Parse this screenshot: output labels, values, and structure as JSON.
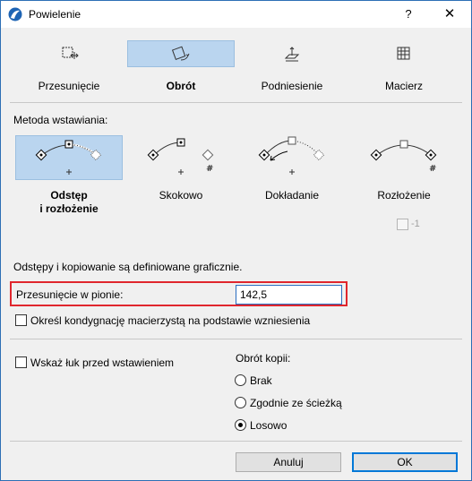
{
  "window": {
    "title": "Powielenie",
    "help_label": "?",
    "close_label": "✕"
  },
  "tabs": [
    {
      "label": "Przesunięcie",
      "icon": "move-icon",
      "active": false
    },
    {
      "label": "Obrót",
      "icon": "rotate-icon",
      "active": true
    },
    {
      "label": "Podniesienie",
      "icon": "elevate-icon",
      "active": false
    },
    {
      "label": "Macierz",
      "icon": "matrix-icon",
      "active": false
    }
  ],
  "method_section": {
    "label": "Metoda wstawiania:",
    "methods": [
      {
        "label_line1": "Odstęp",
        "label_line2": "i rozłożenie",
        "icon": "spacing-distribution-icon",
        "active": true
      },
      {
        "label_line1": "Skokowo",
        "label_line2": "",
        "icon": "step-icon",
        "active": false
      },
      {
        "label_line1": "Dokładanie",
        "label_line2": "",
        "icon": "append-icon",
        "active": false
      },
      {
        "label_line1": "Rozłożenie",
        "label_line2": "",
        "icon": "distribute-icon",
        "active": false
      }
    ],
    "minus_one_label": "-1",
    "minus_one_checked": false,
    "minus_one_enabled": false
  },
  "info_text": "Odstępy i kopiowanie są definiowane graficznie.",
  "vertical_offset": {
    "label": "Przesunięcie w pionie:",
    "value": "142,5"
  },
  "parent_story_checkbox": {
    "label": "Określ kondygnację macierzystą na podstawie wzniesienia",
    "checked": false
  },
  "show_arc_checkbox": {
    "label": "Wskaż łuk przed wstawieniem",
    "checked": false
  },
  "copy_rotation": {
    "label": "Obrót kopii:",
    "options": [
      {
        "label": "Brak",
        "checked": false
      },
      {
        "label": "Zgodnie ze ścieżką",
        "checked": false
      },
      {
        "label": "Losowo",
        "checked": true
      }
    ]
  },
  "buttons": {
    "cancel": "Anuluj",
    "ok": "OK"
  },
  "colors": {
    "accent_blue": "#bad5ef",
    "highlight_red": "#e0262d",
    "focus_blue": "#0078d7"
  }
}
